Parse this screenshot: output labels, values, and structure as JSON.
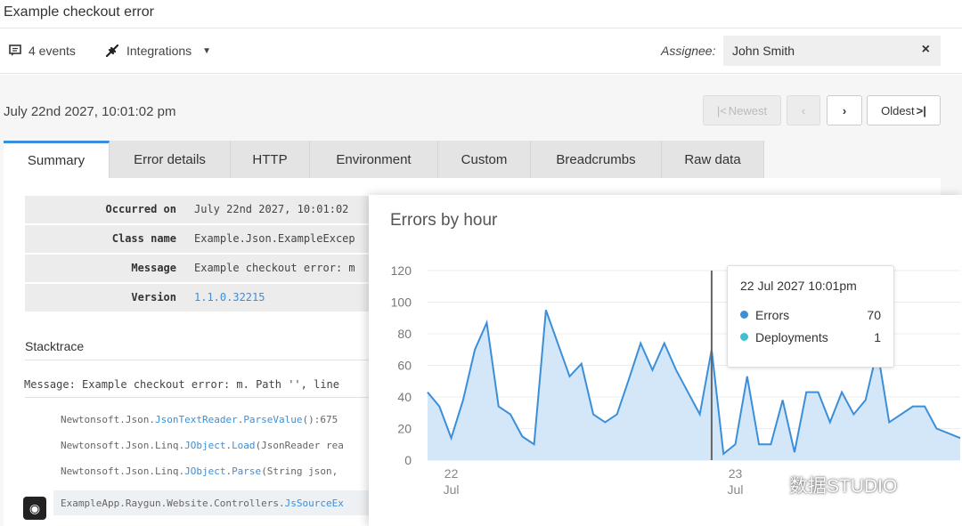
{
  "title": "Example checkout error",
  "toolbar": {
    "events": "4 events",
    "integrations": "Integrations",
    "assignee_label": "Assignee:",
    "assignee_value": "John Smith"
  },
  "date": "July 22nd 2027, 10:01:02 pm",
  "pager": {
    "newest": "Newest",
    "oldest": "Oldest"
  },
  "tabs": [
    "Summary",
    "Error details",
    "HTTP",
    "Environment",
    "Custom",
    "Breadcrumbs",
    "Raw data"
  ],
  "details": [
    {
      "key": "Occurred on",
      "value": "July 22nd 2027, 10:01:02"
    },
    {
      "key": "Class name",
      "value": "Example.Json.ExampleExcep"
    },
    {
      "key": "Message",
      "value": "Example checkout error: m"
    },
    {
      "key": "Version",
      "value": "1.1.0.32215"
    }
  ],
  "stacktrace": {
    "title": "Stacktrace",
    "message": "Message: Example checkout error: m. Path '', line",
    "frames": [
      {
        "ns": "Newtonsoft.Json.",
        "cls": "JsonTextReader",
        "sep": ".",
        "method": "ParseValue",
        "rest": "():675"
      },
      {
        "ns": "Newtonsoft.Json.Linq.",
        "cls": "JObject",
        "sep": ".",
        "method": "Load",
        "rest": "(JsonReader rea"
      },
      {
        "ns": "Newtonsoft.Json.Linq.",
        "cls": "JObject",
        "sep": ".",
        "method": "Parse",
        "rest": "(String json,"
      },
      {
        "ns": "ExampleApp.Raygun.Website.Controllers.",
        "cls": "",
        "sep": "",
        "method": "JsSourceEx",
        "rest": ""
      }
    ]
  },
  "chart_data": {
    "type": "area",
    "title": "Errors by hour",
    "ylim": [
      0,
      120
    ],
    "yticks": [
      0,
      20,
      40,
      60,
      80,
      100,
      120
    ],
    "x_ticks": [
      {
        "pos": 2,
        "day": "22",
        "mon": "Jul"
      },
      {
        "pos": 26,
        "day": "23",
        "mon": "Jul"
      }
    ],
    "grid": true,
    "series": [
      {
        "name": "Errors",
        "color": "#3b8fd9",
        "values": [
          43,
          34,
          14,
          38,
          70,
          87,
          34,
          29,
          15,
          10,
          95,
          74,
          53,
          61,
          29,
          24,
          29,
          51,
          74,
          57,
          74,
          57,
          43,
          29,
          70,
          4,
          10,
          53,
          10,
          10,
          38,
          5,
          43,
          43,
          24,
          43,
          29,
          38,
          70,
          24,
          29,
          34,
          34,
          20,
          17,
          14
        ]
      }
    ],
    "tooltip": {
      "title": "22 Jul 2027 10:01pm",
      "rows": [
        {
          "label": "Errors",
          "value": "70",
          "color": "#3b8fd9"
        },
        {
          "label": "Deployments",
          "value": "1",
          "color": "#3fc0d0"
        }
      ]
    },
    "marker_index": 24
  },
  "watermark": "数据STUDIO",
  "colors": {
    "accent": "#3b8fd9",
    "area_fill": "#d4e7f8"
  },
  "icons": [
    "comment-icon",
    "plug-icon",
    "caret-down-icon",
    "close-icon",
    "github-icon"
  ]
}
